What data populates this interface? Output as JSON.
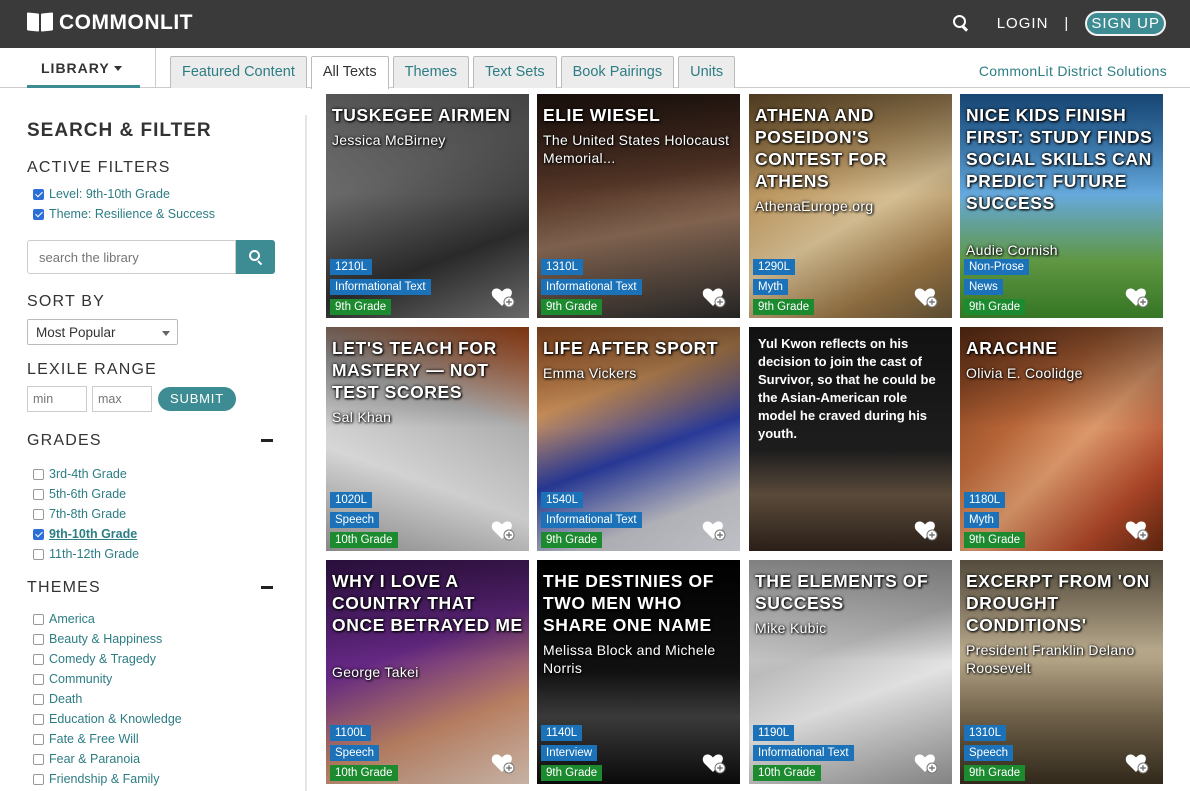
{
  "header": {
    "brand": "COMMONLIT",
    "login": "LOGIN",
    "separator": "|",
    "signup": "SIGN UP"
  },
  "nav": {
    "library": "LIBRARY",
    "tabs": [
      {
        "label": "Featured Content"
      },
      {
        "label": "All Texts"
      },
      {
        "label": "Themes"
      },
      {
        "label": "Text Sets"
      },
      {
        "label": "Book Pairings"
      },
      {
        "label": "Units"
      }
    ],
    "district": "CommonLit District Solutions"
  },
  "sidebar": {
    "title": "SEARCH & FILTER",
    "active_filters_head": "ACTIVE FILTERS",
    "active_filters": [
      "Level: 9th-10th Grade",
      "Theme: Resilience & Success"
    ],
    "search_placeholder": "search the library",
    "sort_head": "SORT BY",
    "sort_value": "Most Popular",
    "lexile_head": "LEXILE RANGE",
    "lexile_min_placeholder": "min",
    "lexile_max_placeholder": "max",
    "submit": "SUBMIT",
    "grades_head": "GRADES",
    "grades": [
      "3rd-4th Grade",
      "5th-6th Grade",
      "7th-8th Grade",
      "9th-10th Grade",
      "11th-12th Grade"
    ],
    "themes_head": "THEMES",
    "themes": [
      "America",
      "Beauty & Happiness",
      "Comedy & Tragedy",
      "Community",
      "Death",
      "Education & Knowledge",
      "Fate & Free Will",
      "Fear & Paranoia",
      "Friendship & Family"
    ]
  },
  "cards": [
    {
      "title": "TUSKEGEE AIRMEN",
      "author": "Jessica McBirney",
      "lexile": "1210L",
      "genre": "Informational Text",
      "grade": "9th Grade"
    },
    {
      "title": "ELIE WIESEL",
      "author": "The United States Holocaust Memorial...",
      "lexile": "1310L",
      "genre": "Informational Text",
      "grade": "9th Grade"
    },
    {
      "title": "ATHENA AND POSEIDON'S CONTEST FOR ATHENS",
      "author": "AthenaEurope.org",
      "lexile": "1290L",
      "genre": "Myth",
      "grade": "9th Grade"
    },
    {
      "title": "NICE KIDS FINISH FIRST: STUDY FINDS SOCIAL SKILLS CAN PREDICT FUTURE SUCCESS",
      "author": "Audie Cornish",
      "lexile": "Non-Prose",
      "genre": "News",
      "grade": "9th Grade"
    },
    {
      "title": "LET'S TEACH FOR MASTERY — NOT TEST SCORES",
      "author": "Sal Khan",
      "lexile": "1020L",
      "genre": "Speech",
      "grade": "10th Grade"
    },
    {
      "title": "LIFE AFTER SPORT",
      "author": "Emma Vickers",
      "lexile": "1540L",
      "genre": "Informational Text",
      "grade": "9th Grade"
    },
    {
      "quote": "Yul Kwon reflects on his decision to join the cast of Survivor, so that he could be the Asian-American role model he craved during his youth."
    },
    {
      "title": "ARACHNE",
      "author": "Olivia E. Coolidge",
      "lexile": "1180L",
      "genre": "Myth",
      "grade": "9th Grade"
    },
    {
      "title": "WHY I LOVE A COUNTRY THAT ONCE BETRAYED ME",
      "author": "George Takei",
      "lexile": "1100L",
      "genre": "Speech",
      "grade": "10th Grade"
    },
    {
      "title": "THE DESTINIES OF TWO MEN WHO SHARE ONE NAME",
      "author": "Melissa Block and Michele Norris",
      "lexile": "1140L",
      "genre": "Interview",
      "grade": "9th Grade"
    },
    {
      "title": "THE ELEMENTS OF SUCCESS",
      "author": "Mike Kubic",
      "lexile": "1190L",
      "genre": "Informational Text",
      "grade": "10th Grade"
    },
    {
      "title": "EXCERPT FROM 'ON DROUGHT CONDITIONS'",
      "author": "President Franklin Delano Roosevelt",
      "lexile": "1310L",
      "genre": "Speech",
      "grade": "9th Grade"
    }
  ]
}
